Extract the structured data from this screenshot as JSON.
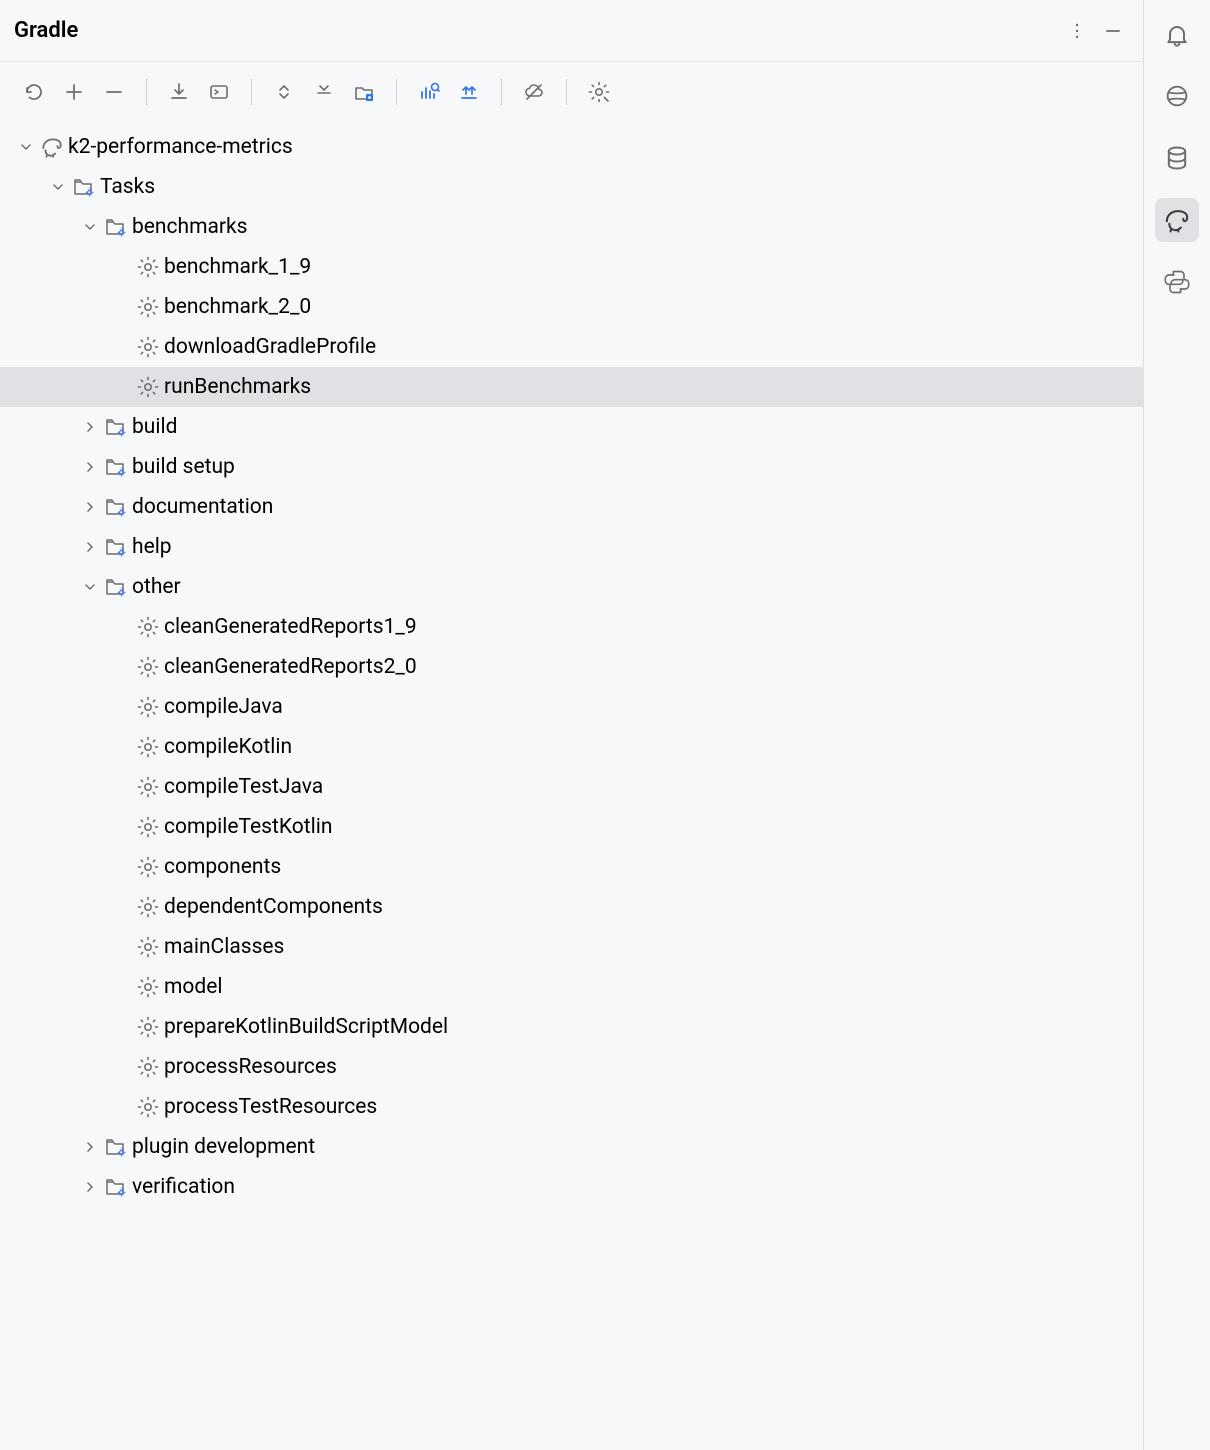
{
  "header": {
    "title": "Gradle"
  },
  "rightSidebar": {
    "items": [
      {
        "name": "notifications-icon"
      },
      {
        "name": "ai-assistant-icon"
      },
      {
        "name": "database-icon"
      },
      {
        "name": "gradle-icon",
        "active": true
      },
      {
        "name": "python-icon"
      }
    ]
  },
  "tree": {
    "project": {
      "label": "k2-performance-metrics",
      "tasks": {
        "label": "Tasks",
        "groups": [
          {
            "name": "benchmarks",
            "expanded": true,
            "tasks": [
              "benchmark_1_9",
              "benchmark_2_0",
              "downloadGradleProfile",
              "runBenchmarks"
            ],
            "selected": "runBenchmarks"
          },
          {
            "name": "build",
            "expanded": false
          },
          {
            "name": "build setup",
            "expanded": false
          },
          {
            "name": "documentation",
            "expanded": false
          },
          {
            "name": "help",
            "expanded": false
          },
          {
            "name": "other",
            "expanded": true,
            "tasks": [
              "cleanGeneratedReports1_9",
              "cleanGeneratedReports2_0",
              "compileJava",
              "compileKotlin",
              "compileTestJava",
              "compileTestKotlin",
              "components",
              "dependentComponents",
              "mainClasses",
              "model",
              "prepareKotlinBuildScriptModel",
              "processResources",
              "processTestResources"
            ]
          },
          {
            "name": "plugin development",
            "expanded": false
          },
          {
            "name": "verification",
            "expanded": false
          }
        ]
      }
    }
  }
}
